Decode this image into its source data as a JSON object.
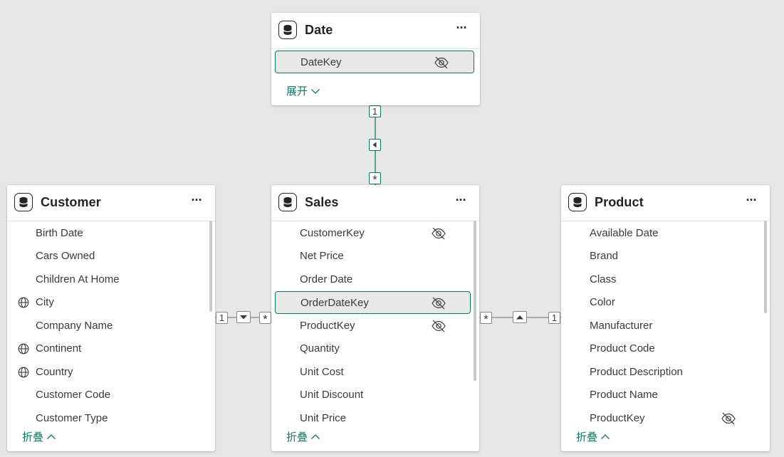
{
  "tables": {
    "date": {
      "title": "Date",
      "more": "···",
      "fields": [
        {
          "label": "DateKey",
          "hidden": true,
          "selected": true
        }
      ],
      "expand_label": "展开"
    },
    "customer": {
      "title": "Customer",
      "more": "···",
      "fields": [
        {
          "label": "Birth Date"
        },
        {
          "label": "Cars Owned"
        },
        {
          "label": "Children At Home"
        },
        {
          "label": "City",
          "icon": "globe-icon"
        },
        {
          "label": "Company Name"
        },
        {
          "label": "Continent",
          "icon": "globe-icon"
        },
        {
          "label": "Country",
          "icon": "globe-icon"
        },
        {
          "label": "Customer Code"
        },
        {
          "label": "Customer Type"
        }
      ],
      "collapse_label": "折叠"
    },
    "sales": {
      "title": "Sales",
      "more": "···",
      "fields": [
        {
          "label": "CustomerKey",
          "hidden": true
        },
        {
          "label": "Net Price"
        },
        {
          "label": "Order Date"
        },
        {
          "label": "OrderDateKey",
          "hidden": true,
          "selected": true
        },
        {
          "label": "ProductKey",
          "hidden": true
        },
        {
          "label": "Quantity"
        },
        {
          "label": "Unit Cost"
        },
        {
          "label": "Unit Discount"
        },
        {
          "label": "Unit Price"
        }
      ],
      "collapse_label": "折叠"
    },
    "product": {
      "title": "Product",
      "more": "···",
      "fields": [
        {
          "label": "Available Date"
        },
        {
          "label": "Brand"
        },
        {
          "label": "Class"
        },
        {
          "label": "Color"
        },
        {
          "label": "Manufacturer"
        },
        {
          "label": "Product Code"
        },
        {
          "label": "Product Description"
        },
        {
          "label": "Product Name"
        },
        {
          "label": "ProductKey",
          "hidden": true
        }
      ],
      "collapse_label": "折叠"
    }
  },
  "relationships": {
    "one_label": "1",
    "many_label": "*"
  },
  "colors": {
    "accent": "#117865",
    "canvas": "#e7e7e7",
    "card": "#ffffff",
    "text": "#252423"
  }
}
